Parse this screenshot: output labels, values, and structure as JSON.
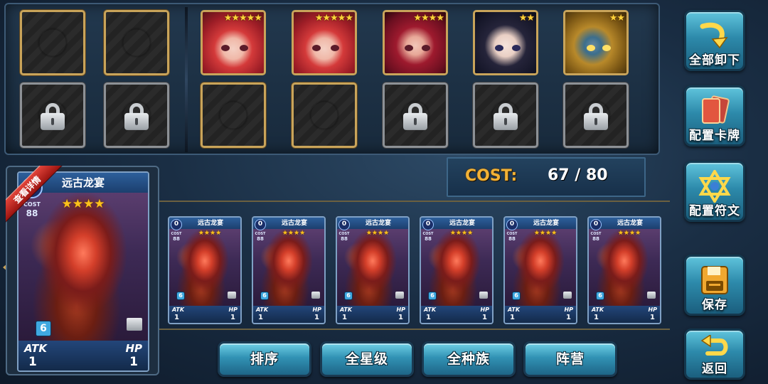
{
  "top_slots": {
    "row1": [
      {
        "kind": "empty"
      },
      {
        "kind": "empty"
      },
      {
        "kind": "hero",
        "stars": "★★★★★",
        "palette": "red"
      },
      {
        "kind": "hero",
        "stars": "★★★★★",
        "palette": "red"
      },
      {
        "kind": "hero",
        "stars": "★★★★",
        "palette": "crimson"
      },
      {
        "kind": "hero",
        "stars": "★★",
        "palette": "dark"
      },
      {
        "kind": "hero",
        "stars": "★★",
        "palette": "gold"
      }
    ],
    "row2": [
      "locked",
      "locked",
      "empty",
      "empty",
      "locked",
      "locked",
      "locked"
    ]
  },
  "side_buttons": {
    "unequip_all": "全部卸下",
    "config_cards": "配置卡牌",
    "config_runes": "配置符文",
    "save": "保存",
    "back": "返回"
  },
  "cost": {
    "label": "COST:",
    "value": "67  /  80"
  },
  "selected_card": {
    "ribbon": "查看详情",
    "name": "远古龙宴",
    "cost_circle": "0",
    "cost_label": "COST",
    "cost_value": "88",
    "stars": "★★★★",
    "badge": "6",
    "atk_label": "ATK",
    "atk": "1",
    "hp_label": "HP",
    "hp": "1"
  },
  "deck_cards": [
    {
      "name": "远古龙宴",
      "cost_circle": "0",
      "cost_label": "COST",
      "cost_value": "88",
      "stars": "★★★★",
      "badge": "6",
      "atk_label": "ATK",
      "atk": "1",
      "hp_label": "HP",
      "hp": "1"
    },
    {
      "name": "远古龙宴",
      "cost_circle": "0",
      "cost_label": "COST",
      "cost_value": "88",
      "stars": "★★★★",
      "badge": "6",
      "atk_label": "ATK",
      "atk": "1",
      "hp_label": "HP",
      "hp": "1"
    },
    {
      "name": "远古龙宴",
      "cost_circle": "0",
      "cost_label": "COST",
      "cost_value": "88",
      "stars": "★★★★",
      "badge": "6",
      "atk_label": "ATK",
      "atk": "1",
      "hp_label": "HP",
      "hp": "1"
    },
    {
      "name": "远古龙宴",
      "cost_circle": "0",
      "cost_label": "COST",
      "cost_value": "88",
      "stars": "★★★★",
      "badge": "6",
      "atk_label": "ATK",
      "atk": "1",
      "hp_label": "HP",
      "hp": "1"
    },
    {
      "name": "远古龙宴",
      "cost_circle": "0",
      "cost_label": "COST",
      "cost_value": "88",
      "stars": "★★★★",
      "badge": "6",
      "atk_label": "ATK",
      "atk": "1",
      "hp_label": "HP",
      "hp": "1"
    },
    {
      "name": "远古龙宴",
      "cost_circle": "0",
      "cost_label": "COST",
      "cost_value": "88",
      "stars": "★★★★",
      "badge": "6",
      "atk_label": "ATK",
      "atk": "1",
      "hp_label": "HP",
      "hp": "1"
    }
  ],
  "filters": {
    "sort": "排序",
    "all_stars": "全星级",
    "all_races": "全种族",
    "faction": "阵营"
  },
  "colors": {
    "gold_frame": "#c9a45a",
    "cost_label": "#f2b236",
    "button_blue": "#3192b4"
  }
}
